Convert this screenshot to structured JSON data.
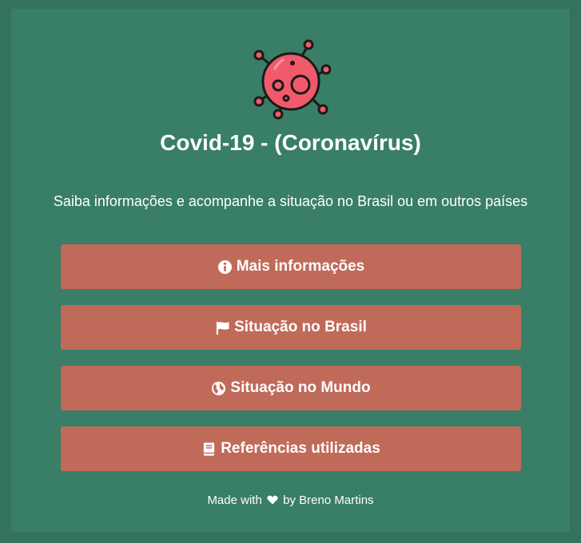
{
  "header": {
    "logo_icon": "virus-icon",
    "title": "Covid-19 - (Coronavírus)",
    "subtitle": "Saiba informações e acompanhe a situação no Brasil ou em outros países"
  },
  "buttons": [
    {
      "label": "Mais informações",
      "icon": "info-circle-icon"
    },
    {
      "label": "Situação no Brasil",
      "icon": "flag-icon"
    },
    {
      "label": "Situação no Mundo",
      "icon": "globe-icon"
    },
    {
      "label": "Referências utilizadas",
      "icon": "book-icon"
    }
  ],
  "footer": {
    "prefix": "Made with",
    "icon": "heart-icon",
    "suffix": "by Breno Martins"
  },
  "colors": {
    "background": "#33725c",
    "card": "#397e66",
    "button": "#c06a59",
    "virus": "#f05a6a"
  }
}
